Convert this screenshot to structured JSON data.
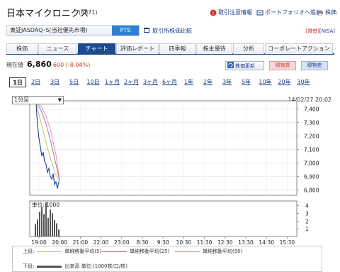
{
  "header": {
    "title": "日本マイクロニクス",
    "code": "(6871)",
    "links": [
      {
        "label": "取引注意情報",
        "icon": "alert-icon"
      },
      {
        "label": "ポートフォリオへ追加",
        "icon": "portfolio-icon"
      },
      {
        "label": "株価",
        "icon": "print-icon"
      }
    ]
  },
  "market": {
    "label": "東証JASDAQ･S(当社優先市場)",
    "pts": "PTS",
    "compare": "取引所株価比較",
    "badge1": "[貸借]",
    "badge2": "[NISA]"
  },
  "nav": {
    "tabs": [
      "株価",
      "ニュース",
      "チャート",
      "評価レポート",
      "四季報",
      "株主優待",
      "分析",
      "コーポレートアクション"
    ],
    "active_index": 2
  },
  "price": {
    "label": "現在値",
    "value": "6,860",
    "change": "-600 (-8.04%)",
    "update_label": "株価更新",
    "buy_label": "現物買",
    "sell_label": "現物売"
  },
  "periods": {
    "items": [
      "1日",
      "2日",
      "3日",
      "5日",
      "10日",
      "1ヶ月",
      "2ヶ月",
      "3ヶ月",
      "6ヶ月",
      "1年",
      "2年",
      "3年",
      "5年",
      "10年",
      "20年",
      "30年"
    ],
    "active_index": 0
  },
  "chart_meta": {
    "interval": "1分足",
    "timestamp": "14/02/27 20:02",
    "volume_unit_label": "単位: 1000",
    "colors": {
      "ma5": "#b6c64a",
      "ma25": "#9b5fd0",
      "ma50": "#e08a8a",
      "price": "#1c3f9a",
      "volume": "#555555"
    }
  },
  "chart_data": [
    {
      "type": "line",
      "x_ticks": [
        "19:00",
        "20:00",
        "21:00",
        "22:00",
        "23:00",
        "8:30",
        "9:30",
        "10:30",
        "11:30",
        "12:30",
        "13:30",
        "14:30",
        "15:30"
      ],
      "y_ticks": [
        6800,
        6900,
        7000,
        7100,
        7200,
        7300,
        7400
      ],
      "ylim": [
        6760,
        7460
      ],
      "series": [
        {
          "name": "株価",
          "x": [
            "19:03",
            "19:05",
            "19:07",
            "19:09",
            "19:11",
            "19:13",
            "19:15",
            "19:17",
            "19:19",
            "19:21",
            "19:23",
            "19:25",
            "19:27",
            "19:29",
            "19:31",
            "19:33",
            "19:35"
          ],
          "values": [
            7430,
            7280,
            7180,
            7120,
            7050,
            7080,
            7010,
            6990,
            6930,
            6960,
            6900,
            6880,
            6920,
            6840,
            6860,
            6810,
            6860
          ]
        },
        {
          "name": "単純移動平均(5)",
          "x": [
            "19:03",
            "19:10",
            "19:17",
            "19:24",
            "19:31",
            "19:36"
          ],
          "values": [
            7440,
            7300,
            7150,
            7020,
            6910,
            6860
          ]
        },
        {
          "name": "単純移動平均(25)",
          "x": [
            "19:03",
            "19:10",
            "19:17",
            "19:24",
            "19:31",
            "19:36"
          ],
          "values": [
            7450,
            7390,
            7290,
            7150,
            6990,
            6870
          ]
        },
        {
          "name": "単純移動平均(50)",
          "x": [
            "19:03",
            "19:10",
            "19:17",
            "19:24",
            "19:31",
            "19:36"
          ],
          "values": [
            7455,
            7420,
            7350,
            7230,
            7060,
            6880
          ]
        }
      ]
    },
    {
      "type": "bar",
      "y_ticks": [
        1,
        2,
        3,
        4
      ],
      "ylim": [
        0,
        4.6
      ],
      "series": [
        {
          "name": "出来高",
          "x": [
            "19:02",
            "19:05",
            "19:08",
            "19:11",
            "19:14",
            "19:17",
            "19:20",
            "19:23",
            "19:26",
            "19:29",
            "19:32",
            "19:35"
          ],
          "values": [
            1.6,
            2.2,
            3.2,
            3.8,
            2.9,
            4.4,
            2.4,
            3.5,
            3.0,
            2.1,
            1.7,
            0.9
          ]
        }
      ]
    }
  ],
  "legend": {
    "upper_label": "上段:",
    "lower_label": "下段:",
    "ma5": "単純移動平均(5)",
    "ma25": "単純移動平均(25)",
    "ma50": "単純移動平均(50)",
    "volume": "出来高 単位:(1000株/口/枚)"
  }
}
